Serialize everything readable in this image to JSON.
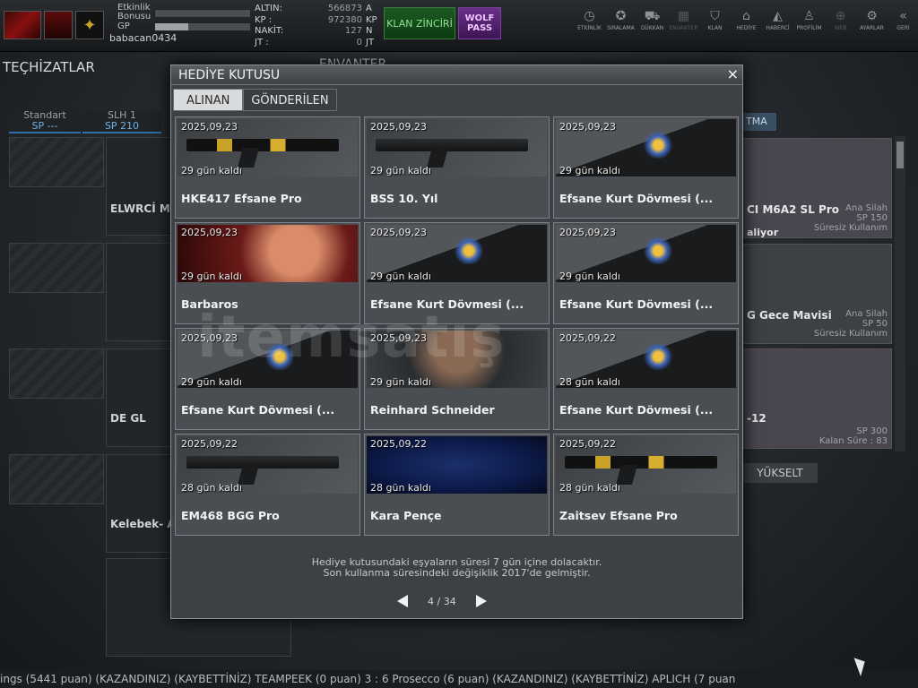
{
  "user": {
    "name": "babacan0434",
    "bonus_label": "Etkinlik Bonusu",
    "gp_label": "GP",
    "bonus_fill": 0,
    "gp_fill": 0.35
  },
  "currency": [
    {
      "key": "ALTIN:",
      "value": "566873",
      "unit": "A"
    },
    {
      "key": "KP  :",
      "value": "972380",
      "unit": "KP"
    },
    {
      "key": "NAKİT:",
      "value": "127",
      "unit": "N"
    },
    {
      "key": "JT   :",
      "value": "0",
      "unit": "JT"
    }
  ],
  "buttons": {
    "klan": "KLAN ZİNCİRİ",
    "wolf": "WOLF PASS"
  },
  "nav": [
    {
      "label": "ETKİNLİK",
      "icon": "clock-icon",
      "glyph": "◷"
    },
    {
      "label": "SIRALAMA",
      "icon": "ranking-icon",
      "glyph": "✪"
    },
    {
      "label": "DÜKKAN",
      "icon": "cart-icon",
      "glyph": "⛟"
    },
    {
      "label": "ENVANTER",
      "icon": "inventory-icon",
      "glyph": "▦",
      "dim": true
    },
    {
      "label": "KLAN",
      "icon": "shield-icon",
      "glyph": "⛉"
    },
    {
      "label": "HEDİYE",
      "icon": "gift-icon",
      "glyph": "⌂"
    },
    {
      "label": "HABERCİ",
      "icon": "megaphone-icon",
      "glyph": "◭"
    },
    {
      "label": "PROFİLİM",
      "icon": "profile-icon",
      "glyph": "♙"
    },
    {
      "label": "WEB",
      "icon": "globe-icon",
      "glyph": "⊕",
      "dim": true
    },
    {
      "label": "AYARLAR",
      "icon": "gear-icon",
      "glyph": "⚙"
    },
    {
      "label": "GERİ",
      "icon": "back-icon",
      "glyph": "«"
    }
  ],
  "background": {
    "techizat": "TEÇHİZATLAR",
    "envanter": "ENVANTER",
    "tab_standart": {
      "label": "Standart",
      "sp": "SP ---"
    },
    "tab_slh": {
      "label": "SLH 1",
      "sp": "SP 210"
    },
    "slots": [
      "ELWRCİ M",
      "",
      "DE GL",
      "Kelebek- A"
    ],
    "right_tab": "TMA",
    "yukselt": "YÜKSELT",
    "right_cards": [
      {
        "name": "CI M6A2 SL Pro",
        "sub": "aliyor",
        "cat": "Ana Silah",
        "sp": "SP 150",
        "usage": "Süresiz Kullanım"
      },
      {
        "name": "G Gece Mavisi",
        "sub": "",
        "cat": "Ana Silah",
        "sp": "SP 50",
        "usage": "Süresiz Kullanım"
      },
      {
        "name": "-12",
        "sub": "",
        "cat": "",
        "sp": "SP 300",
        "usage": "Kalan Süre : 83"
      }
    ],
    "ticker": "ings (5441 puan) (KAZANDINIZ)        (KAYBETTİNİZ) TEAMPEEK (0 puan) 3 : 6 Prosecco (6 puan) (KAZANDINIZ)        (KAYBETTİNİZ) APLICH (7 puan"
  },
  "modal": {
    "title": "HEDİYE KUTUSU",
    "close": "×",
    "tabs": [
      {
        "label": "ALINAN",
        "active": true
      },
      {
        "label": "GÖNDERİLEN",
        "active": false
      }
    ],
    "items": [
      {
        "date": "2025,09,23",
        "left": "29 gün kaldı",
        "name": "HKE417 Efsane Pro",
        "art": "gold"
      },
      {
        "date": "2025,09,23",
        "left": "29 gün kaldı",
        "name": "BSS 10. Yıl",
        "art": "gun"
      },
      {
        "date": "2025,09,23",
        "left": "29 gün kaldı",
        "name": "Efsane Kurt Dövmesi (...",
        "art": "tat"
      },
      {
        "date": "2025,09,23",
        "left": "29 gün kaldı",
        "name": "Barbaros",
        "art": "red"
      },
      {
        "date": "2025,09,23",
        "left": "29 gün kaldı",
        "name": "Efsane Kurt Dövmesi (...",
        "art": "tat"
      },
      {
        "date": "2025,09,23",
        "left": "29 gün kaldı",
        "name": "Efsane Kurt Dövmesi (...",
        "art": "tat"
      },
      {
        "date": "2025,09,23",
        "left": "29 gün kaldı",
        "name": "Efsane Kurt Dövmesi (...",
        "art": "tat"
      },
      {
        "date": "2025,09,23",
        "left": "29 gün kaldı",
        "name": "Reinhard Schneider",
        "art": "face"
      },
      {
        "date": "2025,09,22",
        "left": "28 gün kaldı",
        "name": "Efsane Kurt Dövmesi (...",
        "art": "tat"
      },
      {
        "date": "2025,09,22",
        "left": "28 gün kaldı",
        "name": "EM468 BGG Pro",
        "art": "gun"
      },
      {
        "date": "2025,09,22",
        "left": "28 gün kaldı",
        "name": "Kara Pençe",
        "art": "blue"
      },
      {
        "date": "2025,09,22",
        "left": "28 gün kaldı",
        "name": "Zaitsev Efsane Pro",
        "art": "gold"
      }
    ],
    "note_line1": "Hediye kutusundaki eşyaların süresi 7 gün içine dolacaktır.",
    "note_line2": "Son kullanma süresindeki değişiklik 2017'de gelmiştir.",
    "page": "4 / 34"
  },
  "watermark": "itemsatış"
}
